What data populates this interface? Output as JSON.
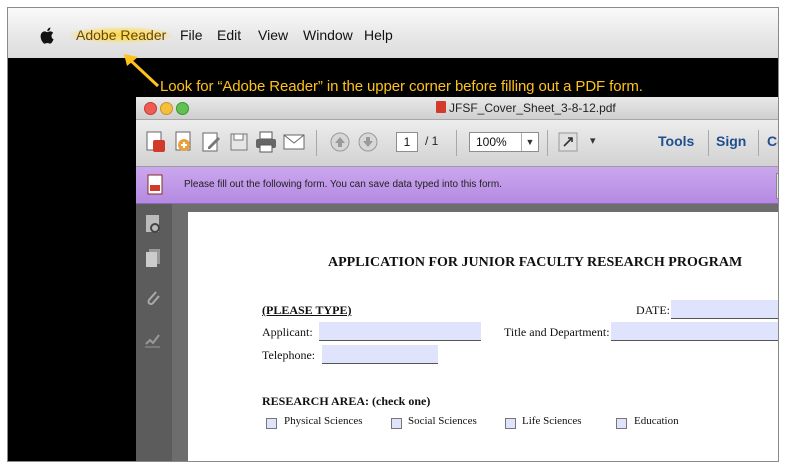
{
  "menubar": {
    "app_name": "Adobe Reader",
    "items": [
      "File",
      "Edit",
      "View",
      "Window",
      "Help"
    ]
  },
  "annotation": {
    "text": "Look for “Adobe Reader” in the upper corner before filling out a PDF form.",
    "color": "#ffc21a"
  },
  "window": {
    "title": "JFSF_Cover_Sheet_3-8-12.pdf"
  },
  "toolbar": {
    "current_page": "1",
    "total_pages": "/ 1",
    "zoom": "100%",
    "tools_label": "Tools",
    "sign_label": "Sign",
    "comment_label": "Co"
  },
  "notice": {
    "text": "Please fill out the following form. You can save data typed into this form."
  },
  "form": {
    "title": "APPLICATION FOR JUNIOR FACULTY RESEARCH PROGRAM",
    "please_type": "(PLEASE TYPE)",
    "date_label": "DATE:",
    "applicant_label": "Applicant:",
    "title_dept_label": "Title and Department:",
    "telephone_label": "Telephone:",
    "research_area_label": "RESEARCH AREA: (check one)",
    "options": [
      "Physical Sciences",
      "Social Sciences",
      "Life Sciences",
      "Education"
    ]
  },
  "colors": {
    "notice_bar": "#b58ae2",
    "field_fill": "#dfe3fb",
    "link_blue": "#1f4f8f"
  },
  "icons": [
    "apple-logo-icon",
    "pdf-file-icon",
    "create-pdf-icon",
    "export-pdf-icon",
    "edit-icon",
    "save-icon",
    "print-icon",
    "email-icon",
    "page-up-icon",
    "page-down-icon",
    "expand-icon",
    "chevron-down-icon",
    "pages-panel-icon",
    "attachments-icon",
    "signatures-icon"
  ]
}
